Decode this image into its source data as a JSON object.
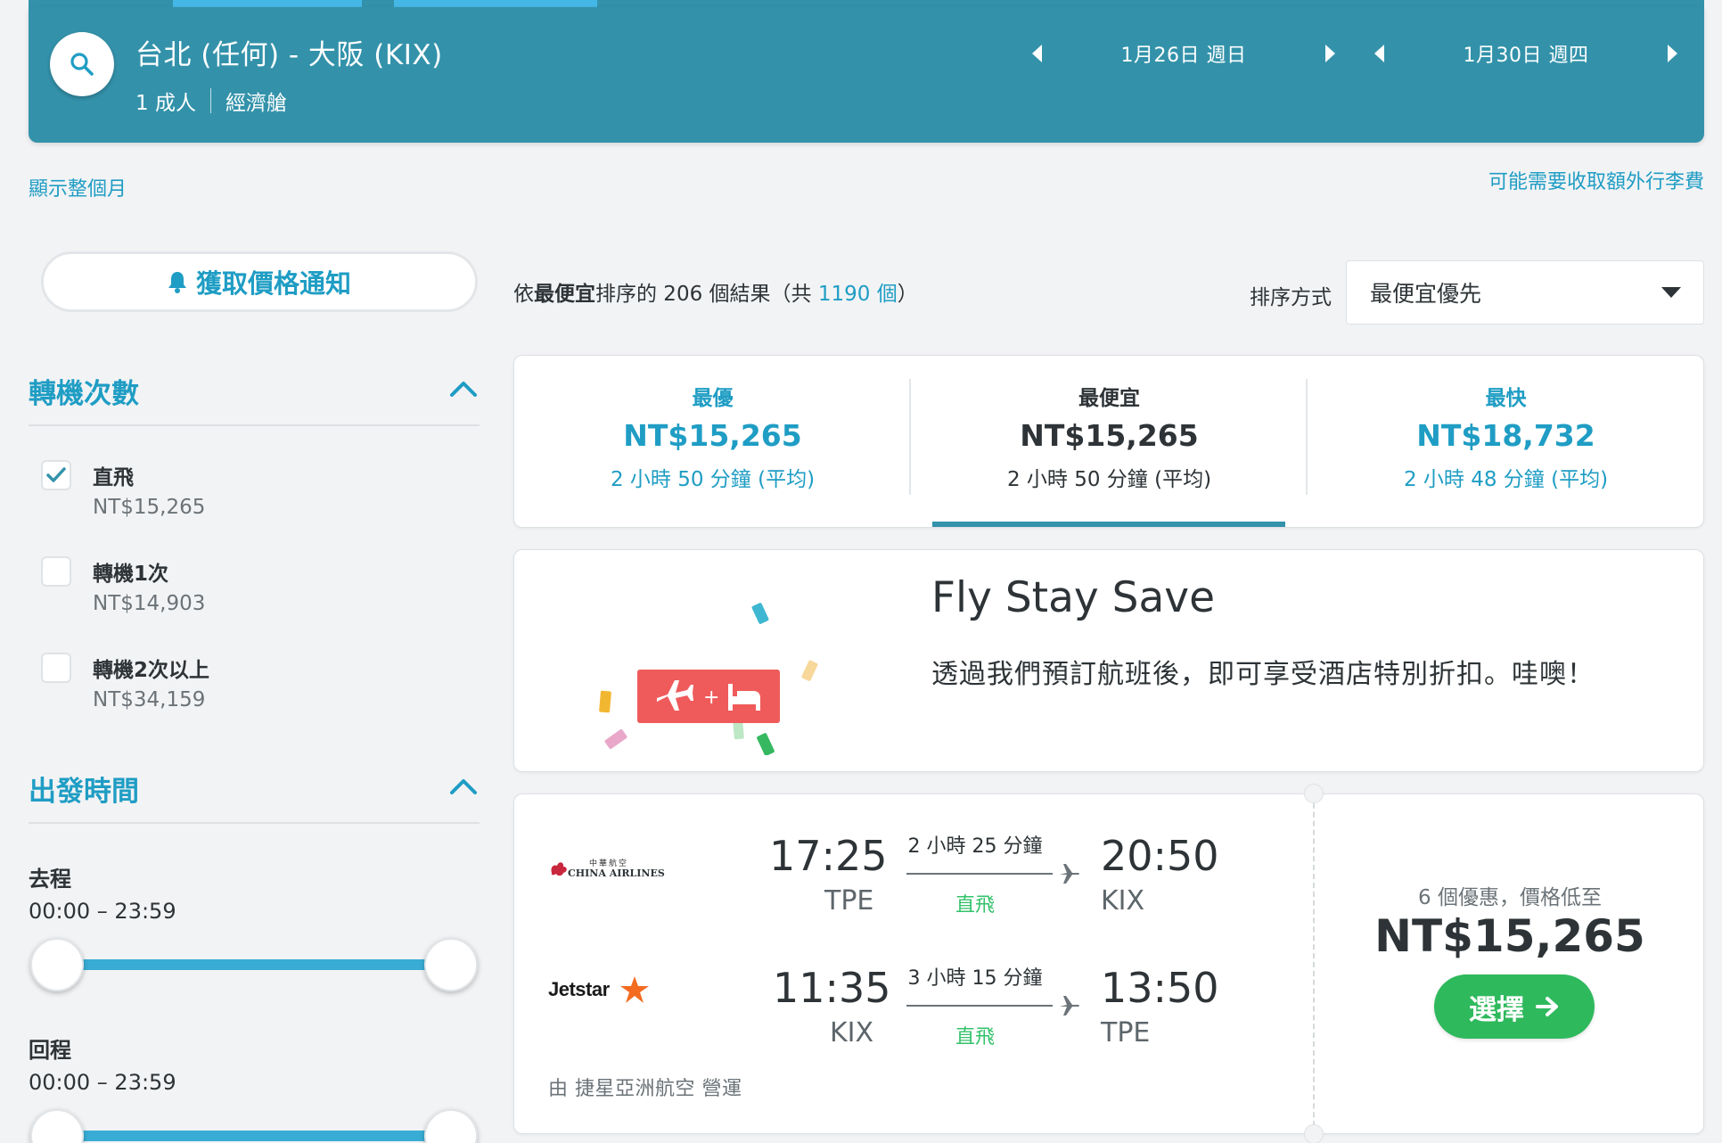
{
  "search": {
    "route": "台北 (任何) - 大阪 (KIX)",
    "passengers": "1 成人",
    "cabin": "經濟艙",
    "depart_date": "1月26日 週日",
    "return_date": "1月30日 週四"
  },
  "links": {
    "show_month": "顯示整個月",
    "baggage_fee": "可能需要收取額外行李費"
  },
  "sidebar": {
    "price_alert_label": "獲取價格通知",
    "stops_title": "轉機次數",
    "stops": [
      {
        "label": "直飛",
        "price": "NT$15,265",
        "checked": true
      },
      {
        "label": "轉機1次",
        "price": "NT$14,903",
        "checked": false
      },
      {
        "label": "轉機2次以上",
        "price": "NT$34,159",
        "checked": false
      }
    ],
    "times_title": "出發時間",
    "outbound_label": "去程",
    "outbound_range": "00:00 – 23:59",
    "return_label": "回程",
    "return_range": "00:00 – 23:59"
  },
  "results": {
    "prefix": "依",
    "sort_word": "最便宜",
    "middle": "排序的 206 個結果（共 ",
    "total": "1190 個",
    "suffix": "）",
    "sort_label": "排序方式",
    "sort_value": "最便宜優先"
  },
  "tabs": [
    {
      "label": "最優",
      "price": "NT$15,265",
      "duration": "2 小時 50 分鐘 (平均)"
    },
    {
      "label": "最便宜",
      "price": "NT$15,265",
      "duration": "2 小時 50 分鐘 (平均)"
    },
    {
      "label": "最快",
      "price": "NT$18,732",
      "duration": "2 小時 48 分鐘 (平均)"
    }
  ],
  "promo": {
    "title": "Fly Stay Save",
    "text": "透過我們預訂航班後，即可享受酒店特別折扣。哇噢！"
  },
  "flight": {
    "legs": [
      {
        "airline": "CHINA AIRLINES",
        "airline_cn": "中華航空",
        "dep_time": "17:25",
        "dep_airport": "TPE",
        "duration": "2 小時 25 分鐘",
        "stops": "直飛",
        "arr_time": "20:50",
        "arr_airport": "KIX"
      },
      {
        "airline": "Jetstar",
        "dep_time": "11:35",
        "dep_airport": "KIX",
        "duration": "3 小時 15 分鐘",
        "stops": "直飛",
        "arr_time": "13:50",
        "arr_airport": "TPE"
      }
    ],
    "operated_by": "由 捷星亞洲航空 營運",
    "deal_text": "6 個優惠，價格低至",
    "deal_price": "NT$15,265",
    "select_label": "選擇"
  },
  "colors": {
    "header": "#3392aa",
    "link": "#1f9dc4",
    "green": "#2fb95d",
    "direct": "#34c26b"
  }
}
